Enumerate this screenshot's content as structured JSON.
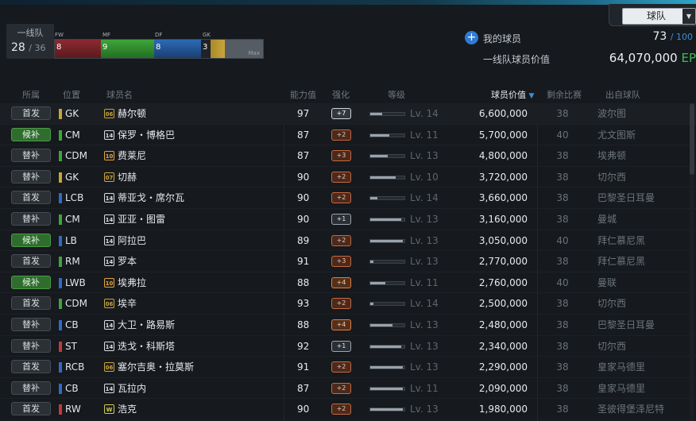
{
  "header": {
    "team_select": {
      "value": "球队"
    },
    "squad": {
      "label": "一线队",
      "count": "28",
      "max": "/ 36"
    },
    "position_bar": {
      "labels": [
        "FW",
        "MF",
        "DF",
        "GK"
      ],
      "counts": [
        "8",
        "9",
        "8",
        "3"
      ],
      "max_label": "Max"
    },
    "my_players": {
      "label": "我的球员",
      "count": "73",
      "max": "/ 100"
    },
    "squad_value": {
      "label": "一线队球员价值",
      "amount": "64,070,000",
      "currency": "EP"
    }
  },
  "table": {
    "columns": [
      "所属",
      "位置",
      "球员名",
      "能力值",
      "强化",
      "等级",
      "球员价值",
      "剩余比赛",
      "出自球队"
    ],
    "sort_icon": "▼",
    "rows": [
      {
        "role": "首发",
        "pos": "GK",
        "pos_color": "#c9a43a",
        "badge": "06",
        "badge_color": "#c9a43a",
        "name": "赫尔顿",
        "ovr": "97",
        "enh": "+7",
        "enh_level": 7,
        "level_fill": 0.35,
        "level": "Lv. 14",
        "value": "6,600,000",
        "games": "38",
        "club": "波尔图"
      },
      {
        "role": "候补",
        "pos": "CM",
        "pos_color": "#3fa63a",
        "badge": "14",
        "badge_color": "#d8dde2",
        "name": "保罗・博格巴",
        "ovr": "87",
        "enh": "+2",
        "enh_level": 2,
        "level_fill": 0.55,
        "level": "Lv. 11",
        "value": "5,700,000",
        "games": "40",
        "club": "尤文图斯"
      },
      {
        "role": "替补",
        "pos": "CDM",
        "pos_color": "#3fa63a",
        "badge": "10",
        "badge_color": "#e0a43a",
        "name": "费莱尼",
        "ovr": "87",
        "enh": "+3",
        "enh_level": 3,
        "level_fill": 0.5,
        "level": "Lv. 13",
        "value": "4,800,000",
        "games": "38",
        "club": "埃弗顿"
      },
      {
        "role": "替补",
        "pos": "GK",
        "pos_color": "#c9a43a",
        "badge": "07",
        "badge_color": "#c9a43a",
        "name": "切赫",
        "ovr": "90",
        "enh": "+2",
        "enh_level": 2,
        "level_fill": 0.75,
        "level": "Lv. 10",
        "value": "3,720,000",
        "games": "38",
        "club": "切尔西"
      },
      {
        "role": "首发",
        "pos": "LCB",
        "pos_color": "#2f6bc6",
        "badge": "14",
        "badge_color": "#d8dde2",
        "name": "蒂亚戈・席尔瓦",
        "ovr": "90",
        "enh": "+2",
        "enh_level": 2,
        "level_fill": 0.2,
        "level": "Lv. 14",
        "value": "3,660,000",
        "games": "38",
        "club": "巴黎圣日耳曼"
      },
      {
        "role": "替补",
        "pos": "CM",
        "pos_color": "#3fa63a",
        "badge": "14",
        "badge_color": "#d8dde2",
        "name": "亚亚・图雷",
        "ovr": "90",
        "enh": "+1",
        "enh_level": 1,
        "level_fill": 0.9,
        "level": "Lv. 13",
        "value": "3,160,000",
        "games": "38",
        "club": "曼城"
      },
      {
        "role": "候补",
        "pos": "LB",
        "pos_color": "#2f6bc6",
        "badge": "14",
        "badge_color": "#d8dde2",
        "name": "阿拉巴",
        "ovr": "89",
        "enh": "+2",
        "enh_level": 2,
        "level_fill": 0.95,
        "level": "Lv. 13",
        "value": "3,050,000",
        "games": "40",
        "club": "拜仁慕尼黑"
      },
      {
        "role": "首发",
        "pos": "RM",
        "pos_color": "#3fa63a",
        "badge": "14",
        "badge_color": "#d8dde2",
        "name": "罗本",
        "ovr": "91",
        "enh": "+3",
        "enh_level": 3,
        "level_fill": 0.1,
        "level": "Lv. 13",
        "value": "2,770,000",
        "games": "38",
        "club": "拜仁慕尼黑"
      },
      {
        "role": "候补",
        "pos": "LWB",
        "pos_color": "#2f6bc6",
        "badge": "10",
        "badge_color": "#e0a43a",
        "name": "埃弗拉",
        "ovr": "88",
        "enh": "+4",
        "enh_level": 4,
        "level_fill": 0.45,
        "level": "Lv. 11",
        "value": "2,760,000",
        "games": "40",
        "club": "曼联"
      },
      {
        "role": "首发",
        "pos": "CDM",
        "pos_color": "#3fa63a",
        "badge": "06",
        "badge_color": "#c9a43a",
        "name": "埃辛",
        "ovr": "93",
        "enh": "+2",
        "enh_level": 2,
        "level_fill": 0.1,
        "level": "Lv. 14",
        "value": "2,500,000",
        "games": "38",
        "club": "切尔西"
      },
      {
        "role": "替补",
        "pos": "CB",
        "pos_color": "#2f6bc6",
        "badge": "14",
        "badge_color": "#d8dde2",
        "name": "大卫・路易斯",
        "ovr": "88",
        "enh": "+4",
        "enh_level": 4,
        "level_fill": 0.65,
        "level": "Lv. 13",
        "value": "2,480,000",
        "games": "38",
        "club": "巴黎圣日耳曼"
      },
      {
        "role": "替补",
        "pos": "ST",
        "pos_color": "#c33a3a",
        "badge": "14",
        "badge_color": "#d8dde2",
        "name": "迭戈・科斯塔",
        "ovr": "92",
        "enh": "+1",
        "enh_level": 1,
        "level_fill": 0.9,
        "level": "Lv. 13",
        "value": "2,340,000",
        "games": "38",
        "club": "切尔西"
      },
      {
        "role": "首发",
        "pos": "RCB",
        "pos_color": "#2f6bc6",
        "badge": "06",
        "badge_color": "#c9a43a",
        "name": "塞尔吉奥・拉莫斯",
        "ovr": "91",
        "enh": "+2",
        "enh_level": 2,
        "level_fill": 0.95,
        "level": "Lv. 13",
        "value": "2,290,000",
        "games": "38",
        "club": "皇家马德里"
      },
      {
        "role": "替补",
        "pos": "CB",
        "pos_color": "#2f6bc6",
        "badge": "14",
        "badge_color": "#d8dde2",
        "name": "瓦拉内",
        "ovr": "87",
        "enh": "+2",
        "enh_level": 2,
        "level_fill": 0.95,
        "level": "Lv. 11",
        "value": "2,090,000",
        "games": "38",
        "club": "皇家马德里"
      },
      {
        "role": "首发",
        "pos": "RW",
        "pos_color": "#c33a3a",
        "badge": "W",
        "badge_color": "#d0c84a",
        "name": "浩克",
        "ovr": "90",
        "enh": "+2",
        "enh_level": 2,
        "level_fill": 0.95,
        "level": "Lv. 13",
        "value": "1,980,000",
        "games": "38",
        "club": "圣彼得堡泽尼特"
      }
    ]
  },
  "icons": {
    "add": "plus-circle-icon",
    "dropdown": "chevron-down-icon"
  }
}
